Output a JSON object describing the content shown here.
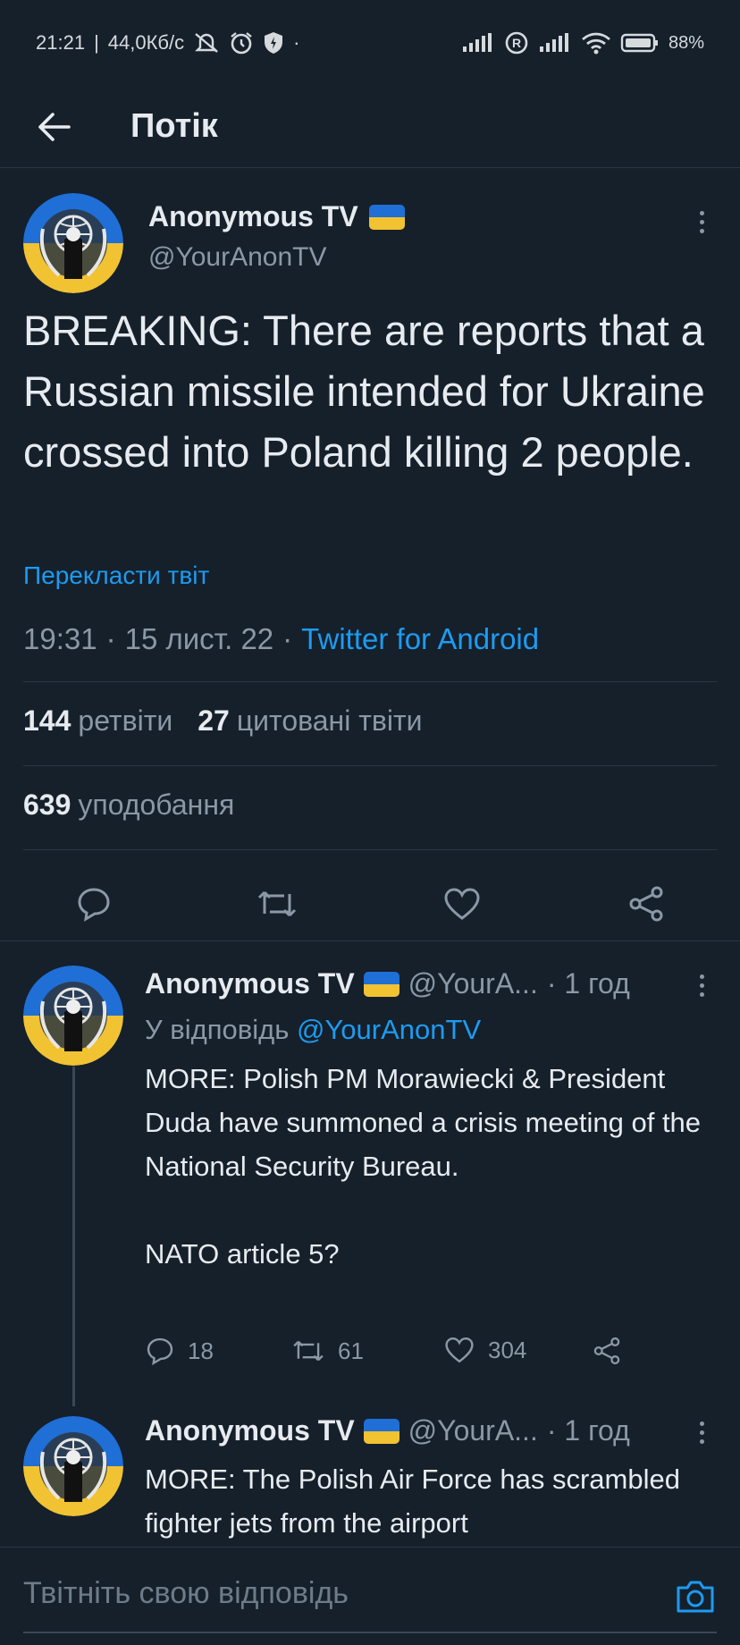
{
  "status_bar": {
    "time": "21:21",
    "network_speed": "44,0Кб/с",
    "battery": "88%",
    "icons": [
      "mute-icon",
      "alarm-icon",
      "shield-icon",
      "signal-icon",
      "roaming-icon",
      "wifi-icon",
      "battery-icon"
    ]
  },
  "header": {
    "title": "Потік"
  },
  "main_tweet": {
    "name": "Anonymous TV",
    "handle": "@YourAnonTV",
    "text": "BREAKING: There are reports that a Russian missile intended for Ukraine crossed into Poland killing 2 people.",
    "translate": "Перекласти твіт",
    "time": "19:31",
    "date": "15 лист. 22",
    "source": "Twitter for Android",
    "retweets": "144",
    "retweets_label": "ретвіти",
    "quotes": "27",
    "quotes_label": "цитовані твіти",
    "likes": "639",
    "likes_label": "уподобання"
  },
  "replies": [
    {
      "name": "Anonymous TV",
      "handle": "@YourA...",
      "time": "· 1 год",
      "reply_to_label": "У відповідь",
      "reply_to_handle": "@YourAnonTV",
      "text": "MORE: Polish PM Morawiecki & President Duda have summoned a crisis meeting of the National Security Bureau.\n\nNATO article 5?",
      "replies": "18",
      "retweets": "61",
      "likes": "304"
    },
    {
      "name": "Anonymous TV",
      "handle": "@YourA...",
      "time": "· 1 год",
      "text": "MORE: The Polish Air Force has scrambled fighter jets from the airport"
    }
  ],
  "compose": {
    "placeholder": "Твітніть свою відповідь"
  },
  "colors": {
    "background": "#15202b",
    "accent": "#1d9bf0",
    "muted": "#8b98a5",
    "flag_blue": "#1f6fd6",
    "flag_yellow": "#f1c232"
  }
}
